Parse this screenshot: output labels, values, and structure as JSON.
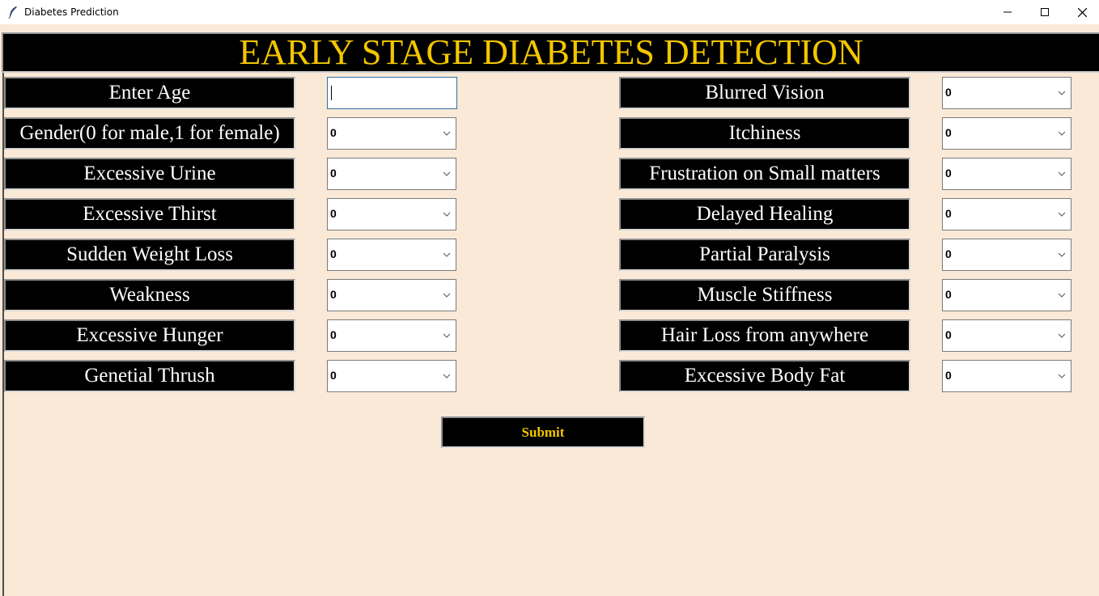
{
  "window": {
    "title": "Diabetes Prediction"
  },
  "header": {
    "title": "EARLY STAGE DIABETES DETECTION",
    "color": "#f3c600"
  },
  "age": {
    "label": "Enter Age",
    "value": ""
  },
  "left_fields": [
    {
      "label": "Gender(0 for male,1 for female)",
      "value": "0"
    },
    {
      "label": "Excessive Urine",
      "value": "0"
    },
    {
      "label": "Excessive Thirst",
      "value": "0"
    },
    {
      "label": "Sudden Weight Loss",
      "value": "0"
    },
    {
      "label": "Weakness",
      "value": "0"
    },
    {
      "label": "Excessive Hunger",
      "value": "0"
    },
    {
      "label": "Genetial Thrush",
      "value": "0"
    }
  ],
  "right_fields": [
    {
      "label": "Blurred Vision",
      "value": "0"
    },
    {
      "label": "Itchiness",
      "value": "0"
    },
    {
      "label": "Frustration on Small matters",
      "value": "0"
    },
    {
      "label": "Delayed Healing",
      "value": "0"
    },
    {
      "label": "Partial Paralysis",
      "value": "0"
    },
    {
      "label": "Muscle Stiffness",
      "value": "0"
    },
    {
      "label": "Hair Loss from anywhere",
      "value": "0"
    },
    {
      "label": "Excessive Body Fat",
      "value": "0"
    }
  ],
  "submit": {
    "label": "Submit"
  },
  "colors": {
    "background": "#fae9d7",
    "label_bg": "#000000",
    "accent": "#f3c600"
  }
}
